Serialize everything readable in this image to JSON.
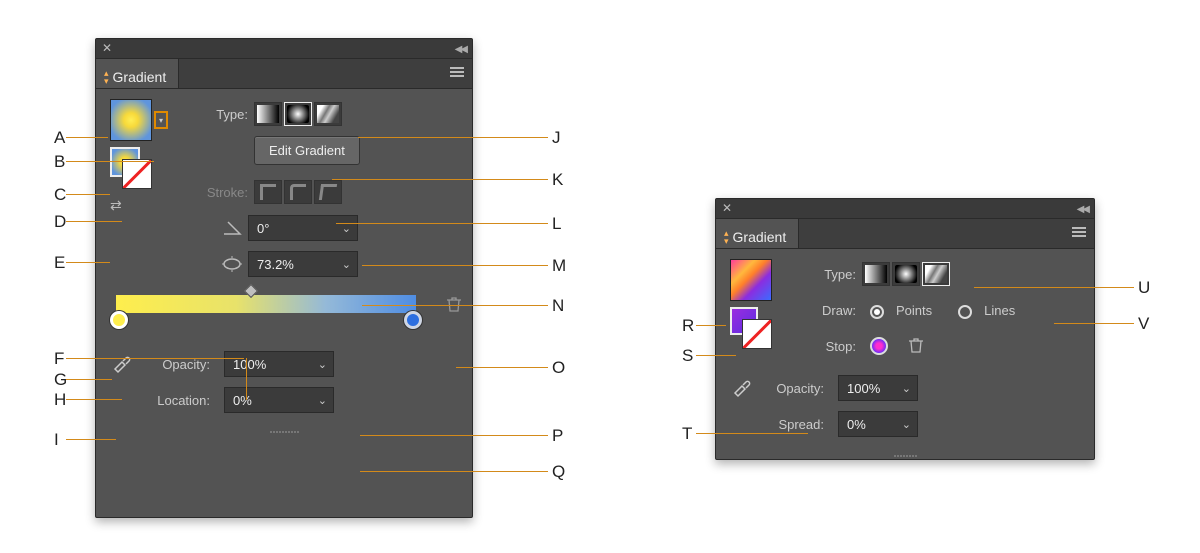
{
  "panel1": {
    "title": "Gradient",
    "type_label": "Type:",
    "edit_button": "Edit Gradient",
    "stroke_label": "Stroke:",
    "angle_value": "0°",
    "aspect_value": "73.2%",
    "opacity_label": "Opacity:",
    "opacity_value": "100%",
    "location_label": "Location:",
    "location_value": "0%"
  },
  "panel2": {
    "title": "Gradient",
    "type_label": "Type:",
    "draw_label": "Draw:",
    "draw_points": "Points",
    "draw_lines": "Lines",
    "stop_label": "Stop:",
    "opacity_label": "Opacity:",
    "opacity_value": "100%",
    "spread_label": "Spread:",
    "spread_value": "0%"
  },
  "callouts": {
    "A": "A",
    "B": "B",
    "C": "C",
    "D": "D",
    "E": "E",
    "F": "F",
    "G": "G",
    "H": "H",
    "I": "I",
    "J": "J",
    "K": "K",
    "L": "L",
    "M": "M",
    "N": "N",
    "O": "O",
    "P": "P",
    "Q": "Q",
    "R": "R",
    "S": "S",
    "T": "T",
    "U": "U",
    "V": "V"
  }
}
